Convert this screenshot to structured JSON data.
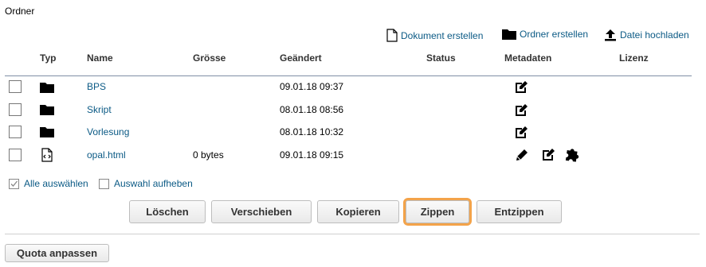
{
  "panel": {
    "title": "Ordner"
  },
  "toolbar": {
    "create_document": "Dokument erstellen",
    "create_folder": "Ordner erstellen",
    "upload_file": "Datei hochladen"
  },
  "table": {
    "columns": {
      "type": "Typ",
      "name": "Name",
      "size": "Grösse",
      "modified": "Geändert",
      "status": "Status",
      "metadata": "Metadaten",
      "license": "Lizenz"
    },
    "rows": [
      {
        "type_icon": "folder-icon",
        "name": "BPS",
        "size": "",
        "modified": "09.01.18 09:37",
        "metadata_icons": [
          "edit-icon"
        ]
      },
      {
        "type_icon": "folder-icon",
        "name": "Skript",
        "size": "",
        "modified": "08.01.18 08:56",
        "metadata_icons": [
          "edit-icon"
        ]
      },
      {
        "type_icon": "folder-icon",
        "name": "Vorlesung",
        "size": "",
        "modified": "08.01.18 10:32",
        "metadata_icons": [
          "edit-icon"
        ]
      },
      {
        "type_icon": "html-file-icon",
        "name": "opal.html",
        "size": "0 bytes",
        "modified": "09.01.18 09:15",
        "metadata_icons": [
          "pencil-icon",
          "edit-icon",
          "puzzle-icon"
        ]
      }
    ]
  },
  "selection": {
    "select_all": "Alle auswählen",
    "deselect": "Auswahl aufheben"
  },
  "actions": {
    "delete": "Löschen",
    "move": "Verschieben",
    "copy": "Kopieren",
    "zip": "Zippen",
    "unzip": "Entzippen"
  },
  "footer": {
    "quota": "Quota anpassen"
  },
  "colors": {
    "link": "#0b5a85",
    "highlight": "#f3a34a"
  }
}
